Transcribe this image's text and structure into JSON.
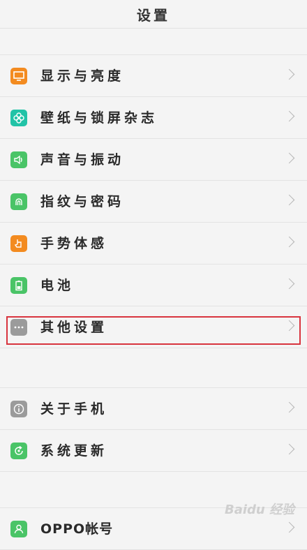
{
  "header": {
    "title": "设置"
  },
  "groups": {
    "display": [
      {
        "label": "显示与亮度",
        "icon": "monitor-icon",
        "color": "#f38b20"
      },
      {
        "label": "壁纸与锁屏杂志",
        "icon": "flower-icon",
        "color": "#22c3a7"
      },
      {
        "label": "声音与振动",
        "icon": "speaker-icon",
        "color": "#4ac467"
      },
      {
        "label": "指纹与密码",
        "icon": "fingerprint-icon",
        "color": "#4ac467"
      },
      {
        "label": "手势体感",
        "icon": "hand-icon",
        "color": "#f38b20"
      },
      {
        "label": "电池",
        "icon": "battery-icon",
        "color": "#4ac467"
      },
      {
        "label": "其他设置",
        "icon": "more-icon",
        "color": "#9b9b9b"
      }
    ],
    "about": [
      {
        "label": "关于手机",
        "icon": "info-icon",
        "color": "#9b9b9b"
      },
      {
        "label": "系统更新",
        "icon": "update-icon",
        "color": "#4ac467"
      }
    ],
    "account": [
      {
        "label": "OPPO帐号",
        "icon": "user-icon",
        "color": "#4ac467"
      }
    ]
  },
  "watermark": "Baidu 经验"
}
